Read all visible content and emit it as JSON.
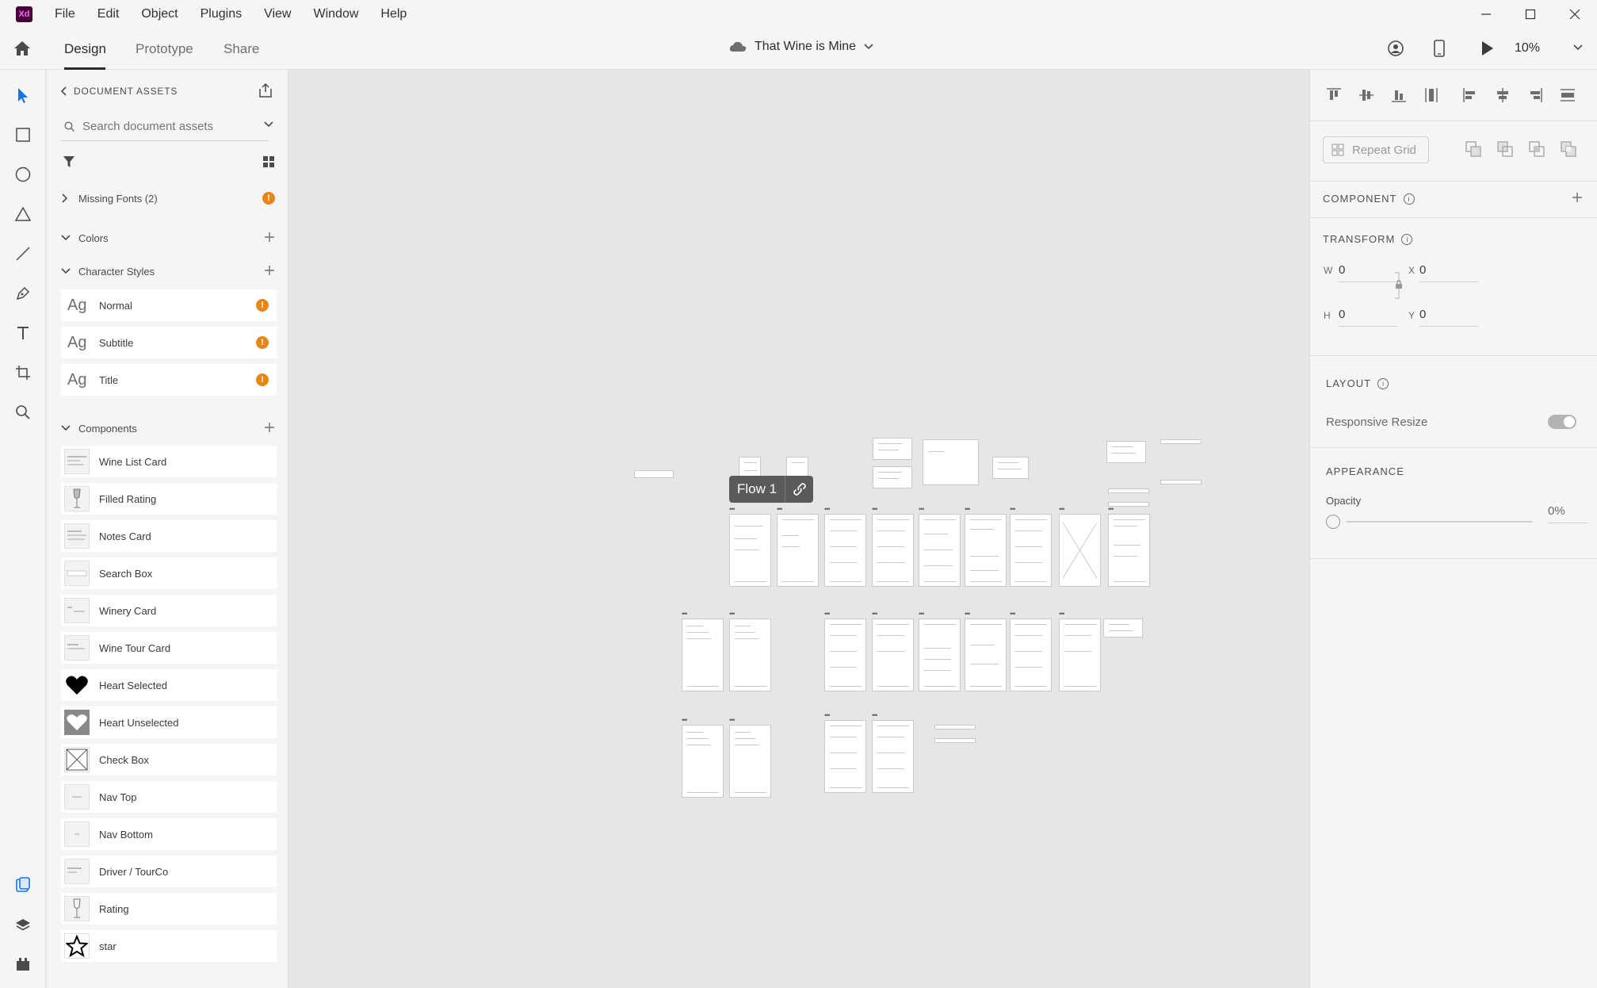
{
  "app": {
    "logo_text": "Xd"
  },
  "menu": [
    "File",
    "Edit",
    "Object",
    "Plugins",
    "View",
    "Window",
    "Help"
  ],
  "toolbar": {
    "tabs": [
      "Design",
      "Prototype",
      "Share"
    ],
    "active_tab": "Design",
    "document_title": "That Wine is Mine",
    "zoom": "10%"
  },
  "assets": {
    "header": "DOCUMENT ASSETS",
    "search_placeholder": "Search document assets",
    "missing_fonts": "Missing Fonts (2)",
    "warn_symbol": "!",
    "colors_label": "Colors",
    "character_styles_label": "Character Styles",
    "ag": "Ag",
    "character_styles": [
      "Normal",
      "Subtitle",
      "Title"
    ],
    "components_label": "Components",
    "components": [
      "Wine List Card",
      "Filled Rating",
      "Notes Card",
      "Search Box",
      "Winery Card",
      "Wine Tour Card",
      "Heart Selected",
      "Heart Unselected",
      "Check Box",
      "Nav Top",
      "Nav Bottom",
      "Driver / TourCo",
      "Rating",
      "star"
    ]
  },
  "canvas": {
    "flow_label": "Flow 1",
    "artboard_menu": "•••"
  },
  "inspector": {
    "repeat_grid": "Repeat Grid",
    "component_heading": "COMPONENT",
    "transform_heading": "TRANSFORM",
    "info_symbol": "i",
    "w_label": "W",
    "w_value": "0",
    "x_label": "X",
    "x_value": "0",
    "h_label": "H",
    "h_value": "0",
    "y_label": "Y",
    "y_value": "0",
    "layout_heading": "LAYOUT",
    "responsive_resize": "Responsive Resize",
    "responsive_resize_enabled": false,
    "appearance_heading": "APPEARANCE",
    "opacity_label": "Opacity",
    "opacity_value": "0%"
  },
  "colors": {
    "accent": "#1473e6",
    "warning": "#e68619",
    "xd_brand": "#470137"
  }
}
